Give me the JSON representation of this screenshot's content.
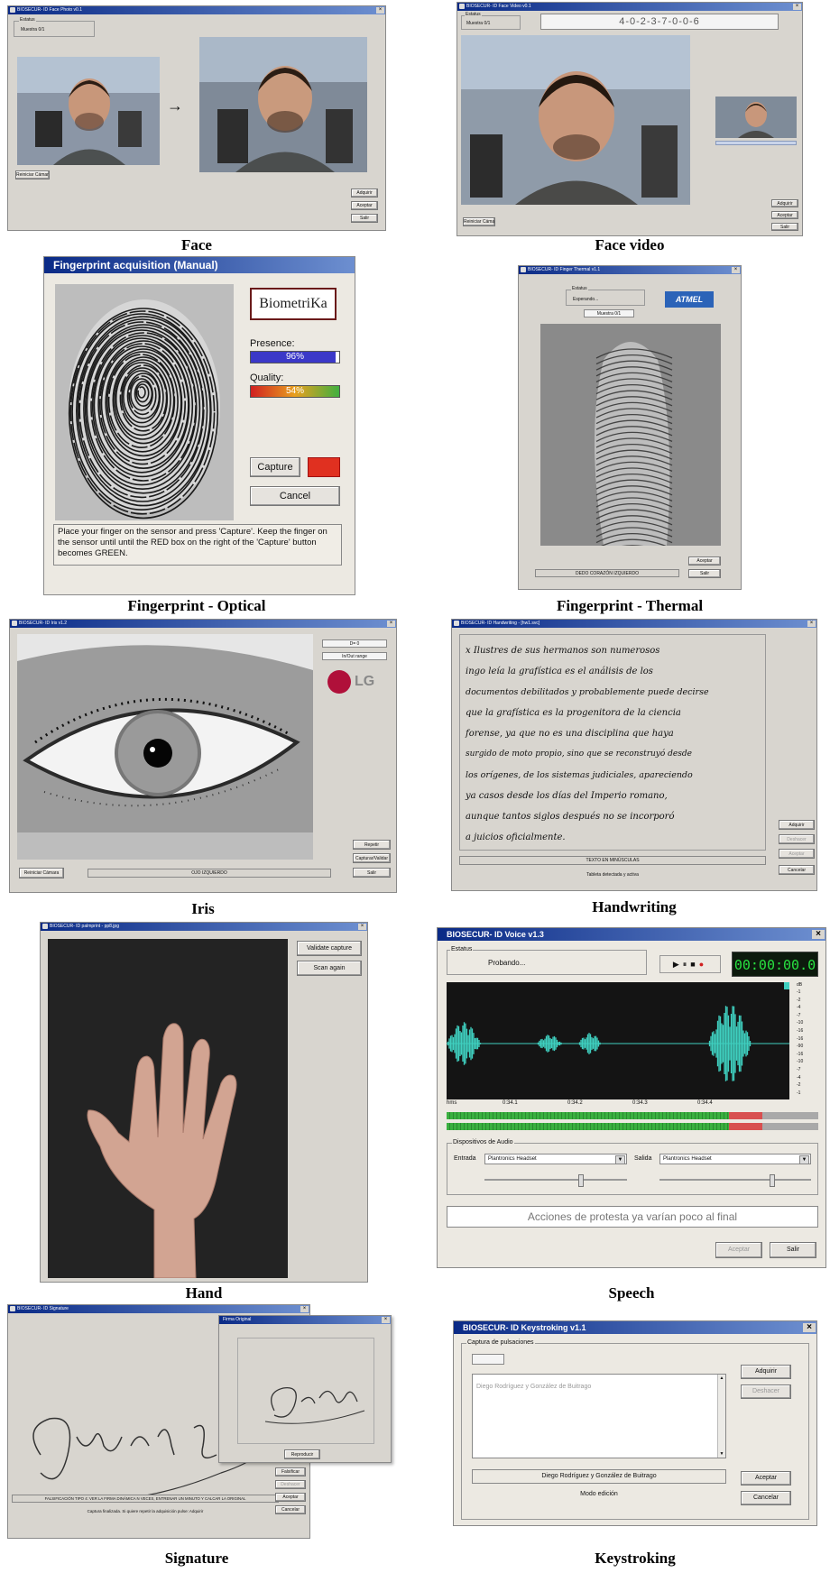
{
  "captions": {
    "face": "Face",
    "face_video": "Face video",
    "fp_optical": "Fingerprint - Optical",
    "fp_thermal": "Fingerprint - Thermal",
    "iris": "Iris",
    "handwriting": "Handwriting",
    "hand": "Hand",
    "speech": "Speech",
    "signature": "Signature",
    "keystroking": "Keystroking"
  },
  "face": {
    "title": "BIOSECUR- ID Face Photo v0.1",
    "status_label": "Estatus",
    "status_value": "Muestra 0/1",
    "arrow": "→",
    "restart_button": "Reiniciar Cámara",
    "buttons": [
      "Adquirir",
      "Aceptar",
      "Salir"
    ]
  },
  "face_video": {
    "title": "BIOSECUR- ID Face Video v0.1",
    "status_label": "Estatus",
    "status_value": "Muestra 0/1",
    "code": "4-0-2-3-7-0-0-6",
    "restart_button": "Reiniciar Cámara",
    "buttons": [
      "Adquirir",
      "Aceptar",
      "Salir"
    ]
  },
  "fp_optical": {
    "title": "Fingerprint acquisition (Manual)",
    "brand": "BiometriKa",
    "presence_label": "Presence:",
    "presence_value": "96%",
    "presence_fraction": 0.96,
    "quality_label": "Quality:",
    "quality_value": "54%",
    "quality_fraction": 0.54,
    "capture_button": "Capture",
    "cancel_button": "Cancel",
    "instructions": "Place your finger on the sensor and press 'Capture'. Keep the finger on the sensor until until the RED box on the right of the 'Capture' button becomes GREEN.",
    "status_color": "#e03020"
  },
  "fp_thermal": {
    "title": "BIOSECUR- ID Finger Thermal v1.1",
    "status_label": "Estatus",
    "status_value": "Esperando...",
    "sample_value": "Muestra 0/1",
    "brand": "ATMEL",
    "finger_label": "DEDO CORAZÓN IZQUIERDO",
    "buttons": [
      "Aceptar",
      "Salir"
    ]
  },
  "iris": {
    "title": "BIOSECUR- ID Iris v1.2",
    "info1": "D= 0",
    "info2": "In/Out range",
    "brand": "LG",
    "restart_button": "Reiniciar Cámara",
    "eye_label": "OJO IZQUIERDO",
    "buttons": [
      "Repetir",
      "Capturar/Validar",
      "Salir"
    ]
  },
  "handwriting": {
    "title": "BIOSECUR- ID Handwriting - [hw1.svc]",
    "lines": [
      "x Ilustres de sus hermanos son numerosos",
      "ingo leía la grafística es el análisis de los",
      "documentos debilitados y probablemente puede decirse",
      "que la grafística es la progenitora de la ciencia",
      "forense, ya que no es una disciplina que haya",
      "surgido de moto propio, sino que se reconstruyó desde",
      "los orígenes, de los sistemas judiciales, apareciendo",
      "ya casos desde los días del Imperio romano,",
      "aunque tantos siglos después no se incorporó",
      "a juicios oficialmente."
    ],
    "mode_label": "TEXTO EN MINÚSCULAS",
    "tablet_status": "Tableta detectada y activa",
    "buttons": [
      "Adquirir",
      "Deshacer",
      "Aceptar",
      "Cancelar"
    ]
  },
  "hand": {
    "title": "BIOSECUR- ID palmprint - pp8.jpg",
    "buttons": [
      "Validate capture",
      "Scan again"
    ]
  },
  "speech": {
    "title": "BIOSECUR- ID Voice v1.3",
    "status_label": "Estatus",
    "status_value": "Probando...",
    "timer": "00:00:00.0",
    "time_ticks": [
      "hms",
      "0:34.1",
      "0:34.2",
      "0:34.3",
      "0:34.4"
    ],
    "db_label": "dB",
    "db_ticks": [
      "-1",
      "-2",
      "-4",
      "-7",
      "-10",
      "-16",
      "-16",
      "-90",
      "-16",
      "-10",
      "-7",
      "-4",
      "-2",
      "-1"
    ],
    "audio_group": "Dispositivos de Audio",
    "input_label": "Entrada",
    "input_value": "Plantronics Headset",
    "output_label": "Salida",
    "output_value": "Plantronics Headset",
    "prompt": "Acciones de protesta ya varían poco al final",
    "buttons": [
      "Aceptar",
      "Salir"
    ],
    "meter_green_fraction": 0.76,
    "meter_red_fraction": 0.09
  },
  "signature": {
    "title": "BIOSECUR- ID Signature",
    "popup_title": "Firma Original",
    "popup_button": "Reproducir",
    "instruction": "FALSIFICACIÓN TIPO 4: VER LA FIRMA DINÁMICA N VECES, ENTRENAR UN MINUTO Y CALCAR LA ORIGINAL",
    "status": "Captura finalizada. Si quiere repetir la adquisición pulse: Adquirir",
    "buttons": [
      "Falsificar",
      "Deshacer",
      "Aceptar",
      "Cancelar"
    ]
  },
  "keystroking": {
    "title": "BIOSECUR- ID Keystroking v1.1",
    "group_label": "Captura de pulsaciones",
    "typed_text": "Diego Rodríguez y González de Buitrago",
    "target_text": "Diego Rodríguez y González de Buitrago",
    "mode": "Modo edición",
    "buttons_top": [
      "Adquirir",
      "Deshacer"
    ],
    "buttons_bottom": [
      "Aceptar",
      "Cancelar"
    ]
  }
}
